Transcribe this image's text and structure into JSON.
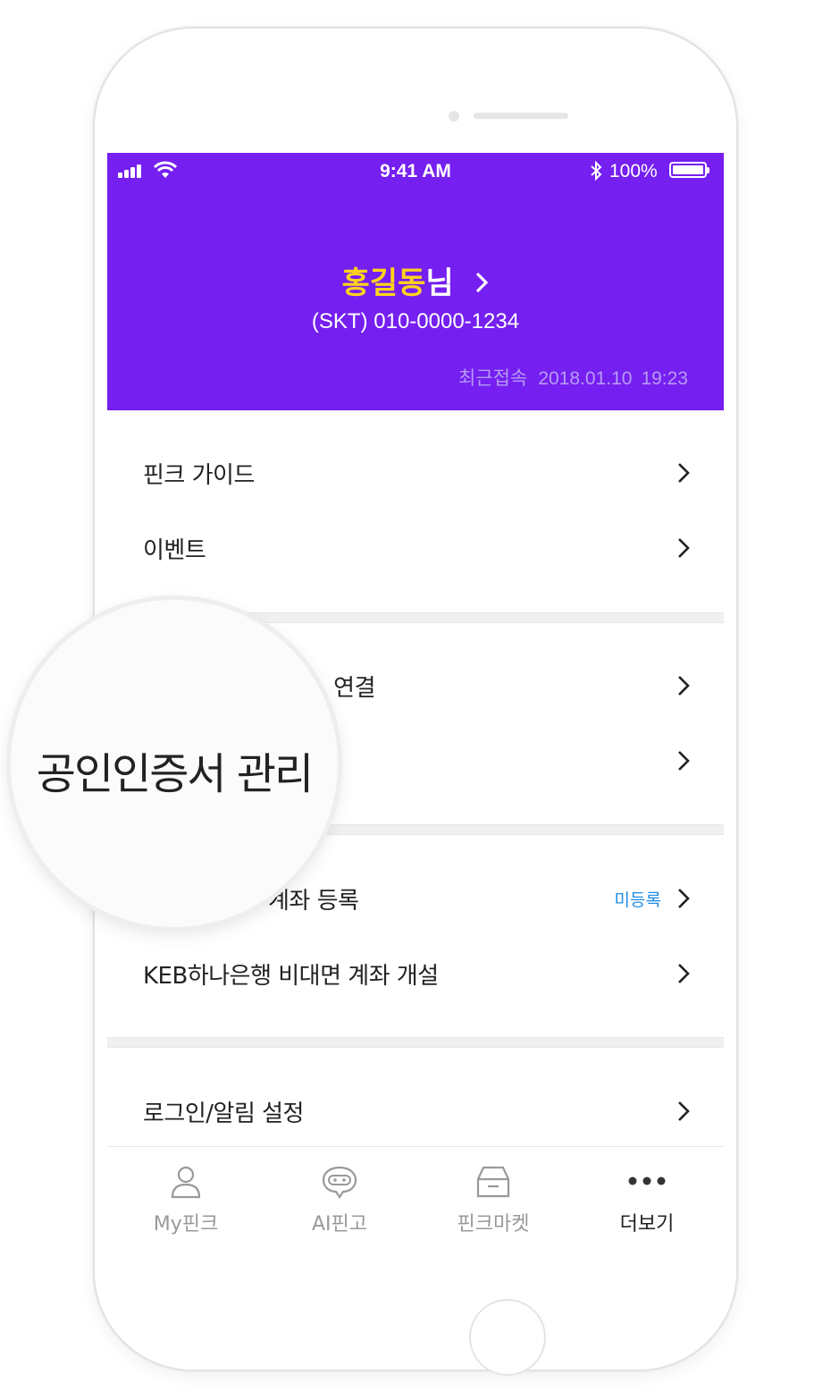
{
  "status_bar": {
    "time": "9:41 AM",
    "battery": "100%"
  },
  "header": {
    "user_name": "홍길동",
    "user_suffix": "님",
    "phone": "(SKT) 010-0000-1234",
    "last_access_label": "최근접속",
    "last_access_date": "2018.01.10",
    "last_access_time": "19:23",
    "background_color": "#751ff0",
    "name_color": "#ffd31c"
  },
  "sections": [
    {
      "items": [
        {
          "label": "핀크 가이드"
        },
        {
          "label": "이벤트"
        }
      ]
    },
    {
      "items": [
        {
          "label": "ㅏ 연결"
        },
        {
          "label": ""
        }
      ]
    },
    {
      "items": [
        {
          "label": "계좌 등록",
          "badge": "미등록"
        },
        {
          "label": "KEB하나은행 비대면 계좌 개설"
        }
      ]
    },
    {
      "items": [
        {
          "label": "로그인/알림 설정"
        }
      ]
    }
  ],
  "magnifier": {
    "label": "공인인증서 관리"
  },
  "tabbar": [
    {
      "label": "My핀크",
      "icon": "person-icon"
    },
    {
      "label": "AI핀고",
      "icon": "chat-robot-icon"
    },
    {
      "label": "핀크마켓",
      "icon": "market-box-icon"
    },
    {
      "label": "더보기",
      "icon": "more-dots-icon",
      "active": true
    }
  ]
}
